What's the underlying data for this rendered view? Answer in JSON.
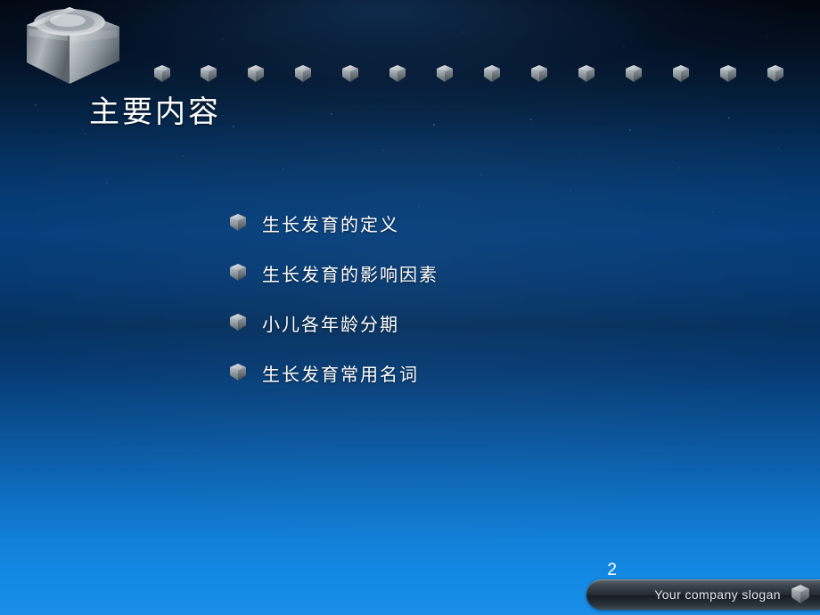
{
  "slide": {
    "title": "主要内容",
    "page_number": "2",
    "footer_text": "Your company slogan",
    "bullets": [
      {
        "icon": "cube-bullet-icon",
        "label": "生长发育的定义"
      },
      {
        "icon": "cube-bullet-icon",
        "label": "生长发育的影响因素"
      },
      {
        "icon": "cube-bullet-icon",
        "label": "小儿各年龄分期"
      },
      {
        "icon": "cube-bullet-icon",
        "label": "生长发育常用名词"
      }
    ],
    "top_cubes_count": 13,
    "colors": {
      "background_top": "#02070f",
      "background_mid": "#063f7c",
      "background_bottom": "#1a8ee8",
      "title_text": "#ffffff",
      "body_text": "#ffffff",
      "footer_bar": "#222a31",
      "footer_text": "#dfe4e8"
    }
  }
}
